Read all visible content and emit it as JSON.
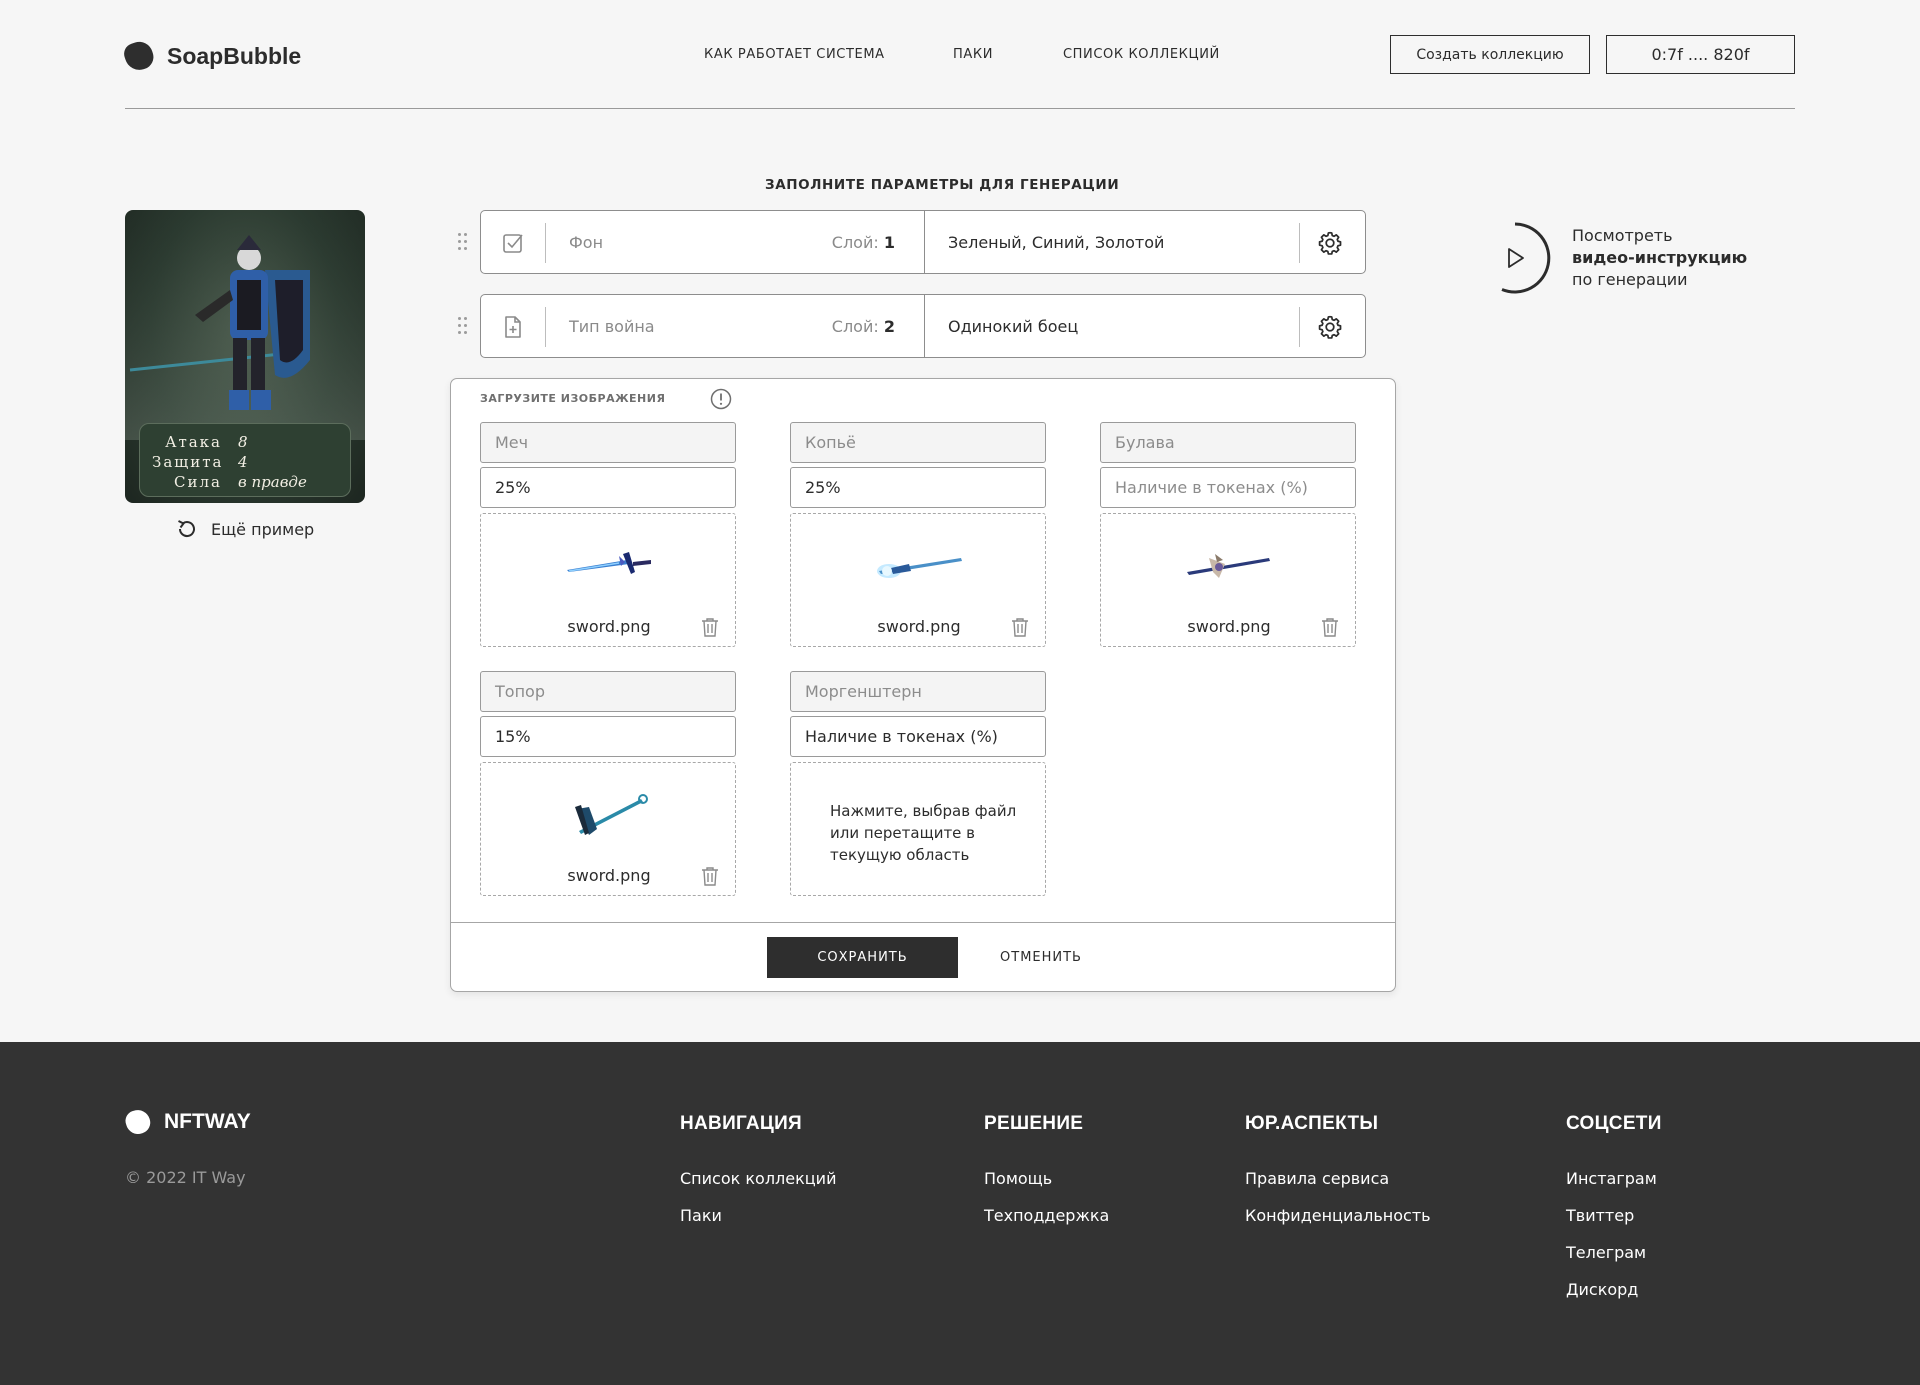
{
  "header": {
    "logo_text": "SoapBubble",
    "nav": [
      "КАК РАБОТАЕТ СИСТЕМА",
      "ПАКИ",
      "СПИСОК КОЛЛЕКЦИЙ"
    ],
    "create_button": "Создать коллекцию",
    "wallet": "0:7f .... 820f"
  },
  "preview_card": {
    "stats": [
      {
        "label": "Атака",
        "value": "8"
      },
      {
        "label": "Защита",
        "value": "4"
      },
      {
        "label": "Сила",
        "value": "в правде"
      }
    ],
    "more_example": "Ещё пример"
  },
  "params": {
    "title": "ЗАПОЛНИТЕ ПАРАМЕТРЫ ДЛЯ ГЕНЕРАЦИИ",
    "layer_prefix": "Слой:",
    "layers": [
      {
        "name": "Фон",
        "layer": "1",
        "value": "Зеленый, Синий, Золотой",
        "icon": "checkbox-icon"
      },
      {
        "name": "Тип война",
        "layer": "2",
        "value": "Одинокий боец",
        "icon": "file-add-icon"
      }
    ]
  },
  "video": {
    "line1": "Посмотреть",
    "line2": "видео-инструкцию",
    "line3": "по генерации"
  },
  "upload": {
    "title": "ЗАГРУЗИТЕ ИЗОБРАЖЕНИЯ",
    "percent_placeholder": "Наличие в токенах (%)",
    "drop_hint": "Нажмите, выбрав файл или перетащите в текущую область",
    "items": [
      {
        "name": "Меч",
        "percent": "25%",
        "file": "sword.png"
      },
      {
        "name": "Копьё",
        "percent": "25%",
        "file": "sword.png"
      },
      {
        "name": "Булава",
        "percent": "",
        "file": "sword.png"
      },
      {
        "name": "Топор",
        "percent": "15%",
        "file": "sword.png"
      },
      {
        "name": "Моргенштерн",
        "percent": "",
        "file": ""
      }
    ],
    "save": "СОХРАНИТЬ",
    "cancel": "ОТМЕНИТЬ"
  },
  "footer": {
    "logo_text": "NFTWAY",
    "copyright": "© 2022 IT Way",
    "columns": [
      {
        "title": "НАВИГАЦИЯ",
        "links": [
          "Список коллекций",
          "Паки"
        ]
      },
      {
        "title": "РЕШЕНИЕ",
        "links": [
          "Помощь",
          "Техподдержка"
        ]
      },
      {
        "title": "ЮР.АСПЕКТЫ",
        "links": [
          "Правила сервиса",
          "Конфиденциальность"
        ]
      },
      {
        "title": "СОЦСЕТИ",
        "links": [
          "Инстаграм",
          "Твиттер",
          "Телеграм",
          "Дискорд"
        ]
      }
    ]
  },
  "colors": {
    "dark": "#2e2e2e",
    "footer_bg": "#333333",
    "page_bg": "#f6f6f6"
  }
}
